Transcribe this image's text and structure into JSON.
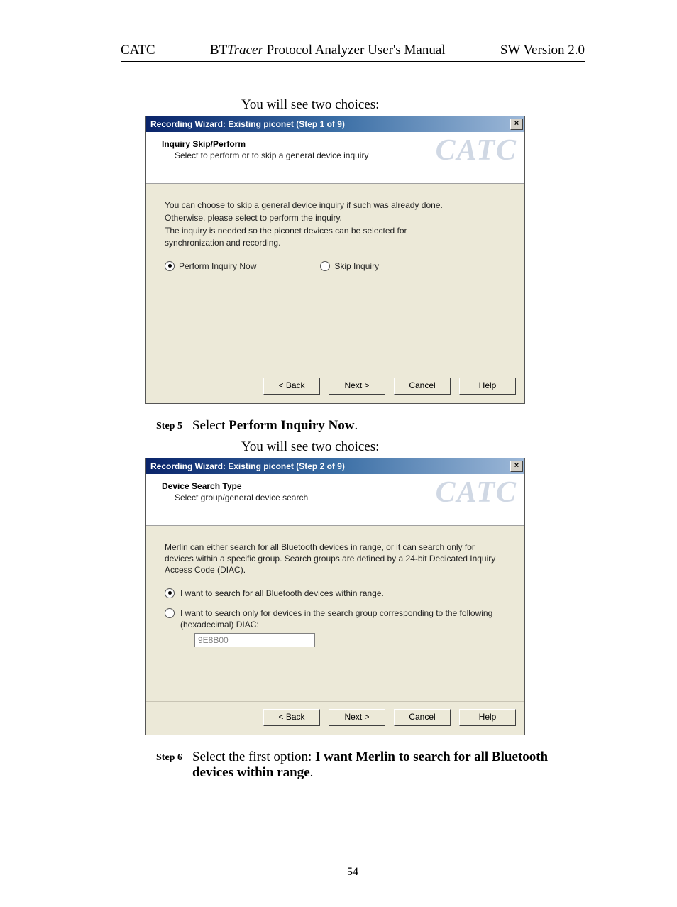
{
  "header": {
    "left": "CATC",
    "center_prefix": "BT",
    "center_italic": "Tracer",
    "center_suffix": " Protocol Analyzer User's Manual",
    "right": "SW Version 2.0"
  },
  "intro1": "You will see two choices:",
  "dialog1": {
    "title": "Recording Wizard: Existing piconet (Step 1 of 9)",
    "watermark": "CATC",
    "banner_title": "Inquiry Skip/Perform",
    "banner_sub": "Select to perform or to skip a general device inquiry",
    "para1": "You can choose to skip a general device inquiry if such was already done.",
    "para2": "Otherwise, please select to perform the inquiry.",
    "para3": "The inquiry is needed so the piconet devices can be selected for synchronization and recording.",
    "radio1_label": "Perform Inquiry Now",
    "radio2_label": "Skip Inquiry",
    "back": "< Back",
    "next": "Next >",
    "cancel": "Cancel",
    "help": "Help"
  },
  "step5": {
    "label": "Step 5",
    "prefix": "Select ",
    "bold": "Perform Inquiry Now",
    "suffix": "."
  },
  "intro2": "You will see two choices:",
  "dialog2": {
    "title": "Recording Wizard: Existing piconet (Step 2 of 9)",
    "watermark": "CATC",
    "banner_title": "Device Search Type",
    "banner_sub": "Select group/general device search",
    "para": "Merlin  can either search for all Bluetooth devices in range, or it can search only for devices within a specific group.  Search groups are defined by a 24-bit Dedicated Inquiry Access Code (DIAC).",
    "radio1_label": "I want to search for all Bluetooth devices within range.",
    "radio2_label": "I want to search only for devices in the search group corresponding to the following (hexadecimal) DIAC:",
    "diac_value": "9E8B00",
    "back": "< Back",
    "next": "Next >",
    "cancel": "Cancel",
    "help": "Help"
  },
  "step6": {
    "label": "Step 6",
    "prefix": "Select the first option:  ",
    "bold": "I want Merlin to search for all Bluetooth devices within range",
    "suffix": "."
  },
  "page_number": "54"
}
